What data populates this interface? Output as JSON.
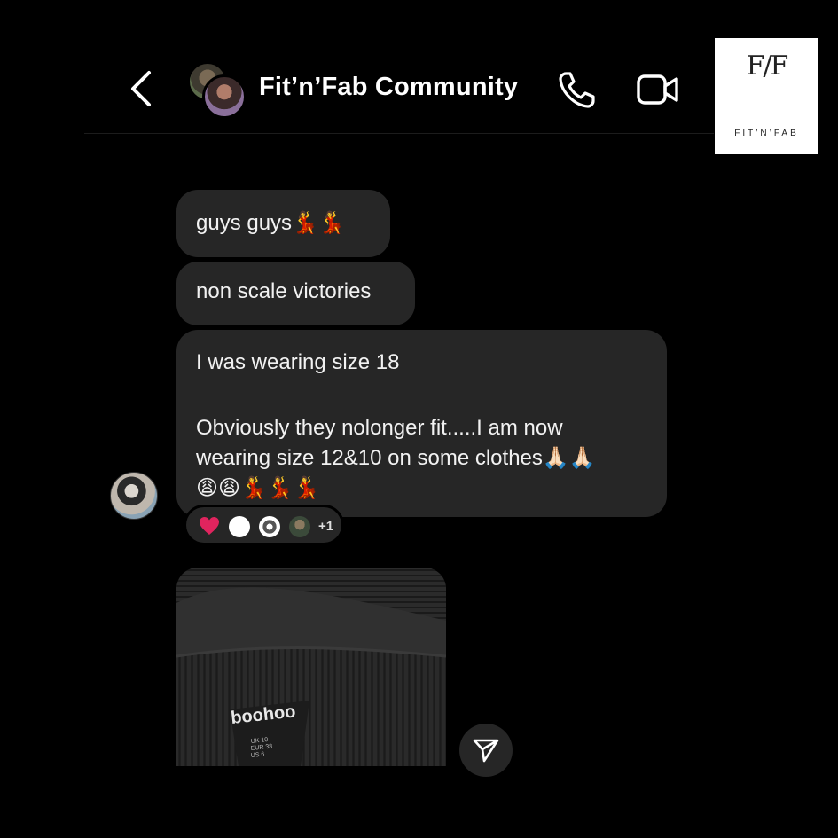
{
  "header": {
    "title": "Fit’n’Fab Community",
    "back_icon": "chevron-left-icon",
    "call_icon": "phone-icon",
    "video_icon": "video-camera-icon"
  },
  "logo": {
    "mark": "F/F",
    "text": "FIT’N’FAB"
  },
  "messages": [
    {
      "text": "guys guys💃💃"
    },
    {
      "text": "non scale victories"
    },
    {
      "lines": [
        "I was wearing size 18",
        "Obviously they nolonger fit.....I am now",
        "wearing size 12&10 on some clothes🙏🏻🙏🏻",
        "😩😩💃💃💃"
      ]
    }
  ],
  "reactions": {
    "emoji": "heart-icon",
    "more_count": "+1"
  },
  "photo": {
    "brand_label": "boohoo",
    "tag_sizes": [
      "UK 10",
      "EUR 38",
      "US 6"
    ]
  },
  "colors": {
    "background": "#000000",
    "bubble": "#262626",
    "text": "#f2f2f2",
    "heart": "#e0245e"
  }
}
